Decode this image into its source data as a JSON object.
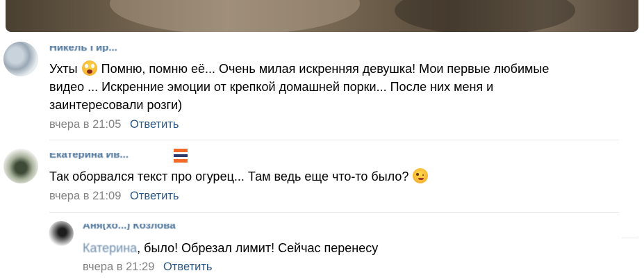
{
  "comments": [
    {
      "author": "Никель Гир...",
      "text_lines": [
        "Ухты 😳 Помню, помню её... Очень милая искренняя девушка! Мои первые любимые",
        "видео ... Искренние эмоции от крепкой домашней порки... После них меня и",
        "заинтересовали розги)"
      ],
      "text_before_emoji": "Ухты",
      "text_after_emoji": "Помню, помню её... Очень милая искренняя девушка! Мои первые любимые",
      "line2": "видео ... Искренние эмоции от крепкой домашней порки... После них меня и",
      "line3": "заинтересовали розги)",
      "time": "вчера в 21:05",
      "reply_label": "Ответить"
    },
    {
      "author": "Екатерина Ив...",
      "text": "Так оборвался текст про огурец... Там ведь еще что-то было?",
      "time": "вчера в 21:09",
      "reply_label": "Ответить"
    },
    {
      "author": "Аня(хо...) Козлова",
      "mention": "Катерина",
      "text": ", было! Обрезал лимит! Сейчас перенесу",
      "time": "вчера в 21:29",
      "reply_label": "Ответить"
    }
  ],
  "icons": {
    "emoji_1": "shocked-face-emoji",
    "emoji_2": "winking-face-emoji"
  },
  "colors": {
    "link": "#2a5885",
    "meta": "#828282",
    "divider": "#e7e8ec"
  }
}
